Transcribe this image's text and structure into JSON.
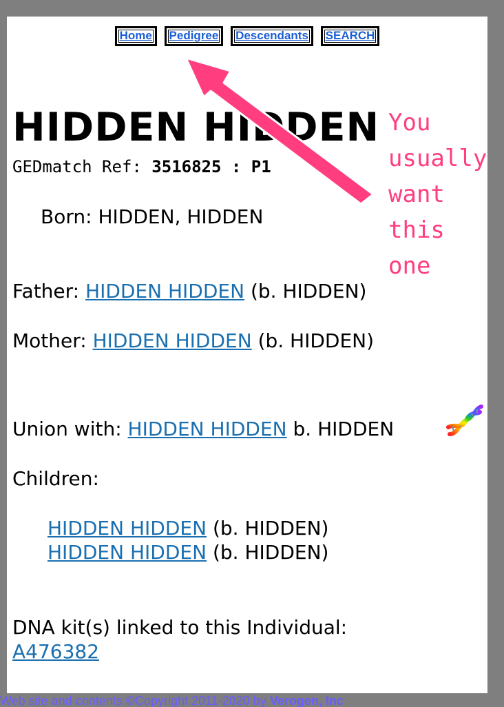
{
  "nav": {
    "home": "Home",
    "pedigree": "Pedigree",
    "descendants": "Descendants",
    "search": "SEARCH"
  },
  "person": {
    "name": "HIDDEN HIDDEN",
    "ref_label": "GEDmatch Ref:",
    "ref_value": "3516825 : P1",
    "born_label": "Born:",
    "born_value": "HIDDEN, HIDDEN"
  },
  "father": {
    "label": "Father:",
    "name": "HIDDEN HIDDEN",
    "birth": "(b. HIDDEN)"
  },
  "mother": {
    "label": "Mother:",
    "name": "HIDDEN HIDDEN",
    "birth": "(b. HIDDEN)"
  },
  "union": {
    "label": "Union with:",
    "name": "HIDDEN HIDDEN",
    "birth": "b. HIDDEN"
  },
  "children": {
    "label": "Children:",
    "items": [
      {
        "name": "HIDDEN HIDDEN",
        "birth": "(b. HIDDEN)"
      },
      {
        "name": "HIDDEN HIDDEN",
        "birth": "(b. HIDDEN)"
      }
    ]
  },
  "dna": {
    "label": "DNA kit(s) linked to this Individual:",
    "kit": "A476382"
  },
  "footer": {
    "text": "Web site and contents ©Copyright 2011-2020 by",
    "company": "Verogen, Inc"
  },
  "annotation": {
    "lines": [
      "You",
      "usually",
      "want",
      "this",
      "one"
    ],
    "color": "#ff3d7f"
  },
  "colors": {
    "link": "#1a6fb0",
    "nav_link": "#1a5fd6",
    "frame": "#7f7f7f",
    "footer": "#6a5cff"
  }
}
